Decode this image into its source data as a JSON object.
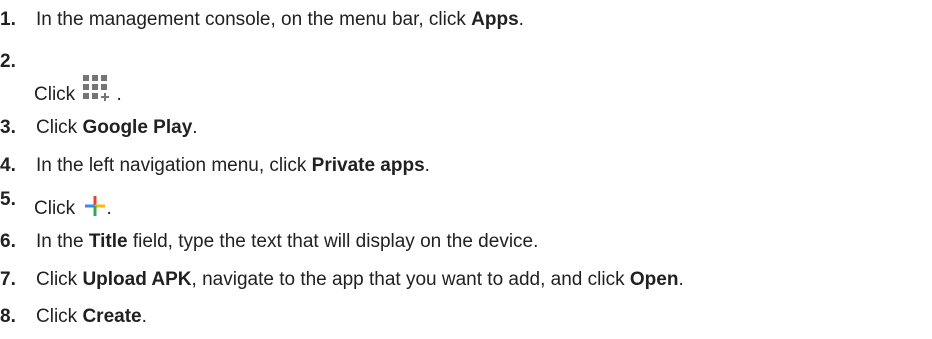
{
  "steps": [
    {
      "number": "1.",
      "parts": [
        "In the management console, on the menu bar, click ",
        "Apps",
        "."
      ]
    },
    {
      "number": "2.",
      "parts": [
        "Click ",
        "."
      ],
      "icon": "apps-grid-add-icon"
    },
    {
      "number": "3.",
      "parts": [
        "Click ",
        "Google Play",
        "."
      ]
    },
    {
      "number": "4.",
      "parts": [
        "In the left navigation menu, click ",
        "Private apps",
        "."
      ]
    },
    {
      "number": "5.",
      "parts": [
        "Click ",
        "."
      ],
      "icon": "colored-plus-icon"
    },
    {
      "number": "6.",
      "parts": [
        "In the ",
        "Title",
        " field, type the text that will display on the device."
      ]
    },
    {
      "number": "7.",
      "parts": [
        "Click ",
        "Upload APK",
        ", navigate to the app that you want to add, and click ",
        "Open",
        "."
      ]
    },
    {
      "number": "8.",
      "parts": [
        "Click ",
        "Create",
        "."
      ]
    }
  ],
  "colors": {
    "text": "#212121",
    "icon_grid": "#757575",
    "plus_blue": "#4285F4",
    "plus_red": "#EA4335",
    "plus_yellow": "#FBBC05",
    "plus_green": "#34A853"
  }
}
